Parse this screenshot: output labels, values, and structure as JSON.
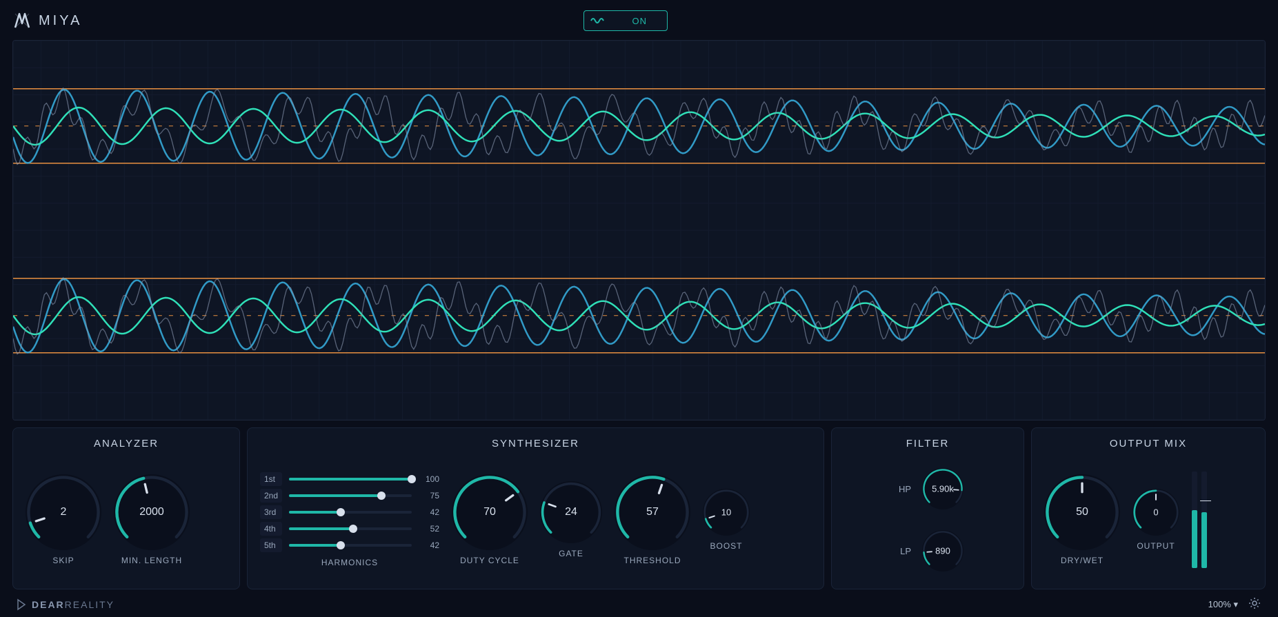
{
  "app_name": "MIYA",
  "power": {
    "state": "ON"
  },
  "analyzer": {
    "title": "ANALYZER",
    "skip": {
      "value": "2",
      "label": "SKIP",
      "pct": 10
    },
    "min_length": {
      "value": "2000",
      "label": "MIN. LENGTH",
      "pct": 45
    }
  },
  "synthesizer": {
    "title": "SYNTHESIZER",
    "harmonics_label": "HARMONICS",
    "harmonics": [
      {
        "label": "1st",
        "value": "100",
        "pct": 100
      },
      {
        "label": "2nd",
        "value": "75",
        "pct": 75
      },
      {
        "label": "3rd",
        "value": "42",
        "pct": 42
      },
      {
        "label": "4th",
        "value": "52",
        "pct": 52
      },
      {
        "label": "5th",
        "value": "42",
        "pct": 42
      }
    ],
    "duty_cycle": {
      "value": "70",
      "label": "DUTY CYCLE",
      "pct": 70
    },
    "gate": {
      "value": "24",
      "label": "GATE",
      "pct": 24
    },
    "threshold": {
      "value": "57",
      "label": "THRESHOLD",
      "pct": 57
    },
    "boost": {
      "value": "10",
      "label": "BOOST",
      "pct": 10
    }
  },
  "filter": {
    "title": "FILTER",
    "hp": {
      "label": "HP",
      "value": "5.90k",
      "pct": 85
    },
    "lp": {
      "label": "LP",
      "value": "890",
      "pct": 15
    }
  },
  "output": {
    "title": "OUTPUT MIX",
    "dry_wet": {
      "value": "50",
      "label": "DRY/WET",
      "pct": 50
    },
    "output": {
      "value": "0",
      "label": "OUTPUT",
      "pct": 50
    },
    "meters": [
      60,
      58
    ]
  },
  "footer": {
    "brand1": "DEAR",
    "brand2": "REALITY",
    "zoom": "100% ▾"
  },
  "colors": {
    "accent": "#1fb8a8",
    "wave_cyan": "#35a8d8",
    "wave_green": "#2fe0b8",
    "wave_gray": "#8a98b0",
    "guide_orange": "#e89040"
  }
}
